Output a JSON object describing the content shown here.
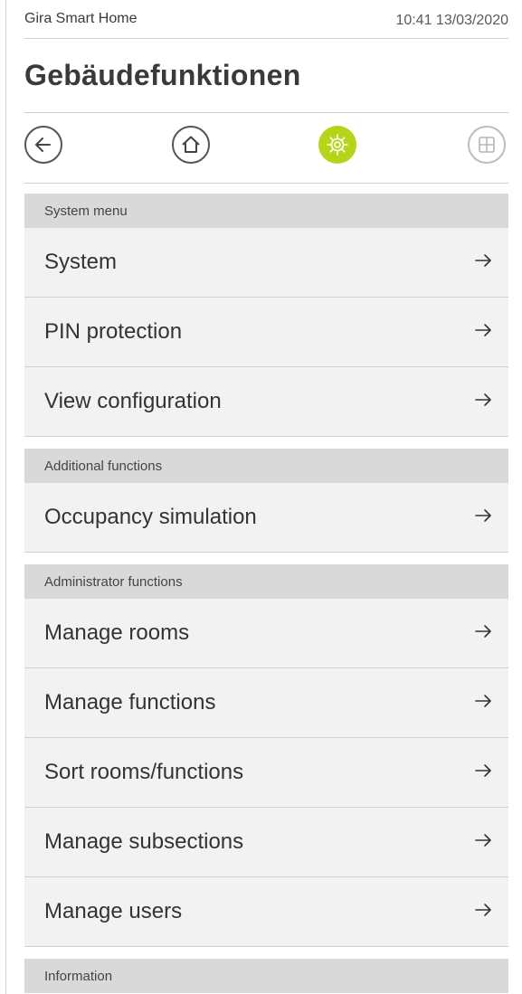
{
  "status_bar": {
    "app_name": "Gira Smart Home",
    "datetime": "10:41 13/03/2020"
  },
  "header": {
    "title": "Gebäudefunktionen"
  },
  "nav": {
    "buttons": [
      {
        "icon": "back-arrow-icon"
      },
      {
        "icon": "home-icon"
      },
      {
        "icon": "settings-gear-icon",
        "active": true,
        "color": "#b8d41a"
      },
      {
        "icon": "grid-icon"
      }
    ]
  },
  "sections": [
    {
      "title": "System menu",
      "items": [
        {
          "label": "System"
        },
        {
          "label": "PIN protection"
        },
        {
          "label": "View configuration"
        }
      ]
    },
    {
      "title": "Additional functions",
      "items": [
        {
          "label": "Occupancy simulation"
        }
      ]
    },
    {
      "title": "Administrator functions",
      "items": [
        {
          "label": "Manage rooms"
        },
        {
          "label": "Manage functions"
        },
        {
          "label": "Sort rooms/functions"
        },
        {
          "label": "Manage subsections"
        },
        {
          "label": "Manage users"
        }
      ]
    },
    {
      "title": "Information",
      "items": []
    }
  ],
  "colors": {
    "accent": "#b8d41a",
    "section_header_bg": "#d9d9d9",
    "item_bg": "#f2f2f2"
  }
}
